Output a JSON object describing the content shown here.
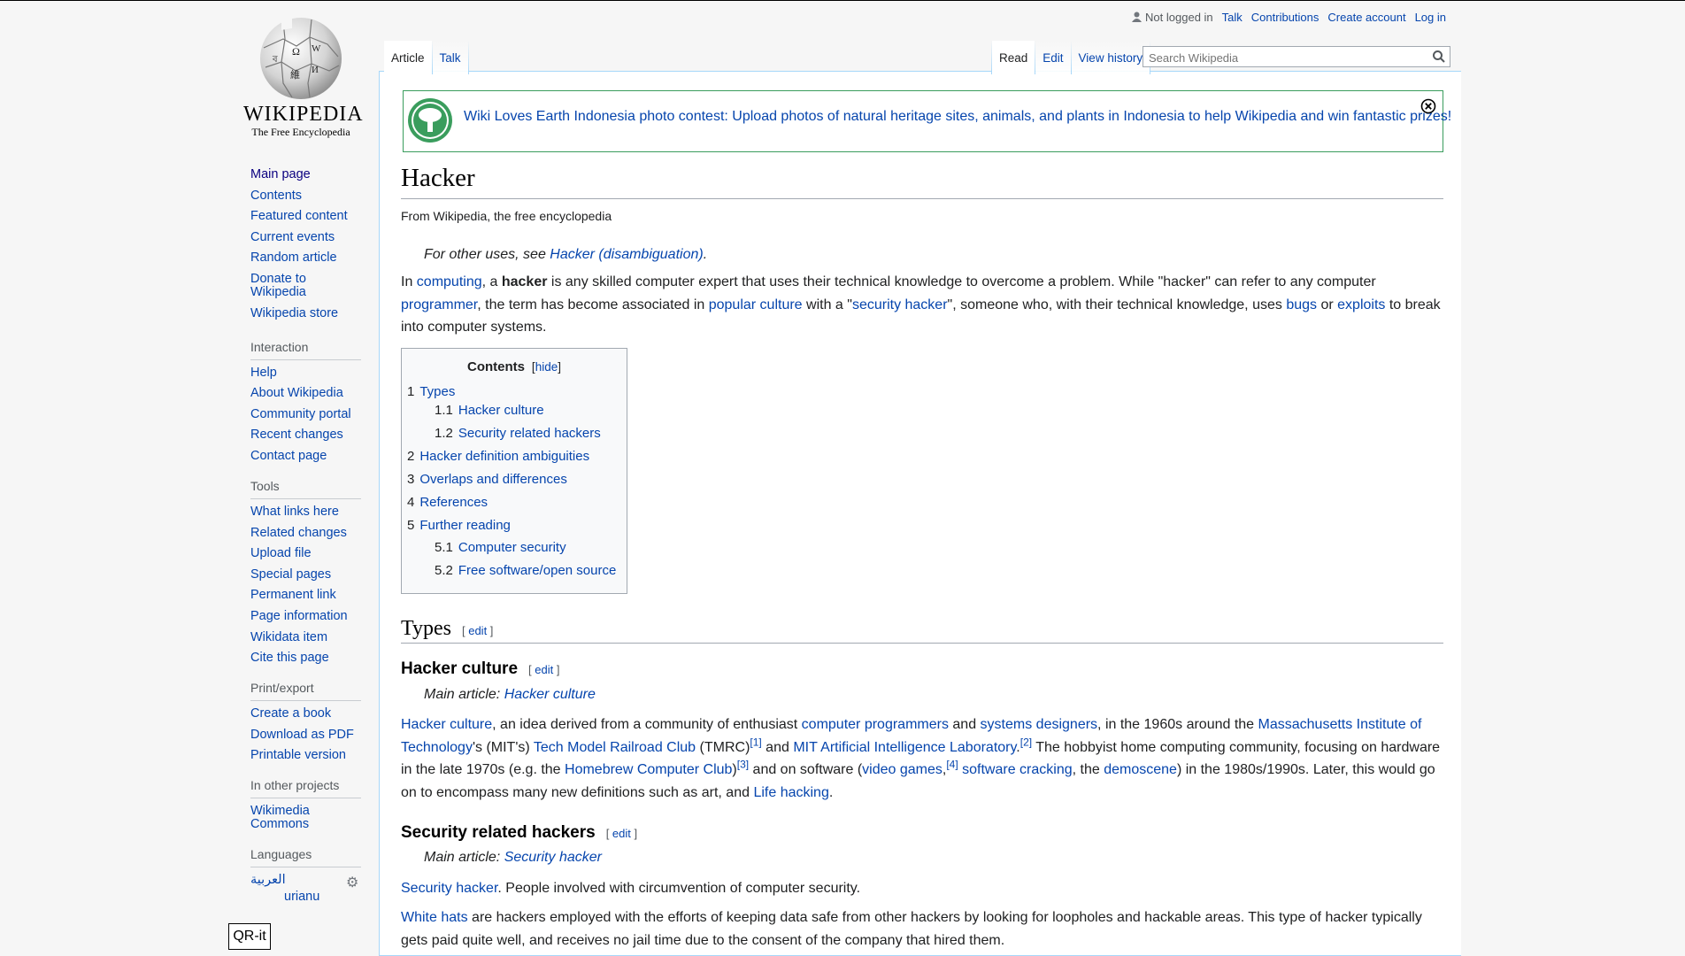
{
  "logo": {
    "wordmark": "WIKIPEDIA",
    "tagline": "The Free Encyclopedia"
  },
  "sidebar": {
    "nav": [
      "Main page",
      "Contents",
      "Featured content",
      "Current events",
      "Random article",
      "Donate to Wikipedia",
      "Wikipedia store"
    ],
    "interaction_heading": "Interaction",
    "interaction": [
      "Help",
      "About Wikipedia",
      "Community portal",
      "Recent changes",
      "Contact page"
    ],
    "tools_heading": "Tools",
    "tools": [
      "What links here",
      "Related changes",
      "Upload file",
      "Special pages",
      "Permanent link",
      "Page information",
      "Wikidata item",
      "Cite this page"
    ],
    "print_heading": "Print/export",
    "print": [
      "Create a book",
      "Download as PDF",
      "Printable version"
    ],
    "projects_heading": "In other projects",
    "projects": [
      "Wikimedia Commons"
    ],
    "languages_heading": "Languages",
    "languages": [
      "العربية",
      "urianu"
    ]
  },
  "qr_label": "QR-it",
  "personal": {
    "status": "Not logged in",
    "links": [
      "Talk",
      "Contributions",
      "Create account",
      "Log in"
    ]
  },
  "tabs": {
    "left": [
      "Article",
      "Talk"
    ],
    "right": [
      "Read",
      "Edit",
      "View history"
    ]
  },
  "search": {
    "placeholder": "Search Wikipedia"
  },
  "banner": {
    "text": "Wiki Loves Earth Indonesia photo contest: Upload photos of natural heritage sites, animals, and plants in Indonesia to help Wikipedia and win fantastic prizes!"
  },
  "article": {
    "title": "Hacker",
    "tagline": "From Wikipedia, the free encyclopedia",
    "hatnote_prefix": "For other uses, see ",
    "hatnote_link": "Hacker (disambiguation)",
    "hatnote_suffix": ".",
    "intro": {
      "t1": "In ",
      "l1": "computing",
      "t2": ", a ",
      "b1": "hacker",
      "t3": " is any skilled computer expert that uses their technical knowledge to overcome a problem. While \"hacker\" can refer to any computer ",
      "l2": "programmer",
      "t4": ", the term has become associated in ",
      "l3": "popular culture",
      "t5": " with a \"",
      "l4": "security hacker",
      "t6": "\", someone who, with their technical knowledge, uses ",
      "l5": "bugs",
      "t7": " or ",
      "l6": "exploits",
      "t8": " to break into computer systems."
    },
    "toc": {
      "title": "Contents",
      "hide": "hide",
      "items": [
        {
          "num": "1",
          "label": "Types"
        },
        {
          "num": "1.1",
          "label": "Hacker culture"
        },
        {
          "num": "1.2",
          "label": "Security related hackers"
        },
        {
          "num": "2",
          "label": "Hacker definition ambiguities"
        },
        {
          "num": "3",
          "label": "Overlaps and differences"
        },
        {
          "num": "4",
          "label": "References"
        },
        {
          "num": "5",
          "label": "Further reading"
        },
        {
          "num": "5.1",
          "label": "Computer security"
        },
        {
          "num": "5.2",
          "label": "Free software/open source"
        }
      ]
    },
    "edit_label": "edit",
    "types_heading": "Types",
    "culture_heading": "Hacker culture",
    "main_article_prefix": "Main article: ",
    "culture_main": "Hacker culture",
    "culture_para": {
      "l1": "Hacker culture",
      "t1": ", an idea derived from a community of enthusiast ",
      "l2": "computer programmers",
      "t2": " and ",
      "l3": "systems designers",
      "t3": ", in the 1960s around the ",
      "l4": "Massachusetts Institute of Technology",
      "t4": "'s (MIT's) ",
      "l5": "Tech Model Railroad Club",
      "t5": " (TMRC)",
      "r1": "[1]",
      "t6": " and ",
      "l6": "MIT Artificial Intelligence Laboratory",
      "t7": ".",
      "r2": "[2]",
      "t8": " The hobbyist home computing community, focusing on hardware in the late 1970s (e.g. the ",
      "l7": "Homebrew Computer Club",
      "t9": ")",
      "r3": "[3]",
      "t10": " and on software (",
      "l8": "video games",
      "t11": ",",
      "r4": "[4]",
      "t12": " ",
      "l9": "software cracking",
      "t13": ", the ",
      "l10": "demoscene",
      "t14": ") in the 1980s/1990s. Later, this would go on to encompass many new definitions such as art, and ",
      "l11": "Life hacking",
      "t15": "."
    },
    "security_heading": "Security related hackers",
    "security_main": "Security hacker",
    "security_para1": {
      "l1": "Security hacker",
      "t1": ". People involved with circumvention of computer security."
    },
    "security_para2": {
      "l1": "White hats",
      "t1": " are hackers employed with the efforts of keeping data safe from other hackers by looking for loopholes and hackable areas. This type of hacker typically gets paid quite well, and receives no jail time due to the consent of the company that hired them."
    }
  },
  "colors": {
    "link": "#0645ad",
    "banner_border": "#3a9d5d",
    "text": "#202122"
  }
}
